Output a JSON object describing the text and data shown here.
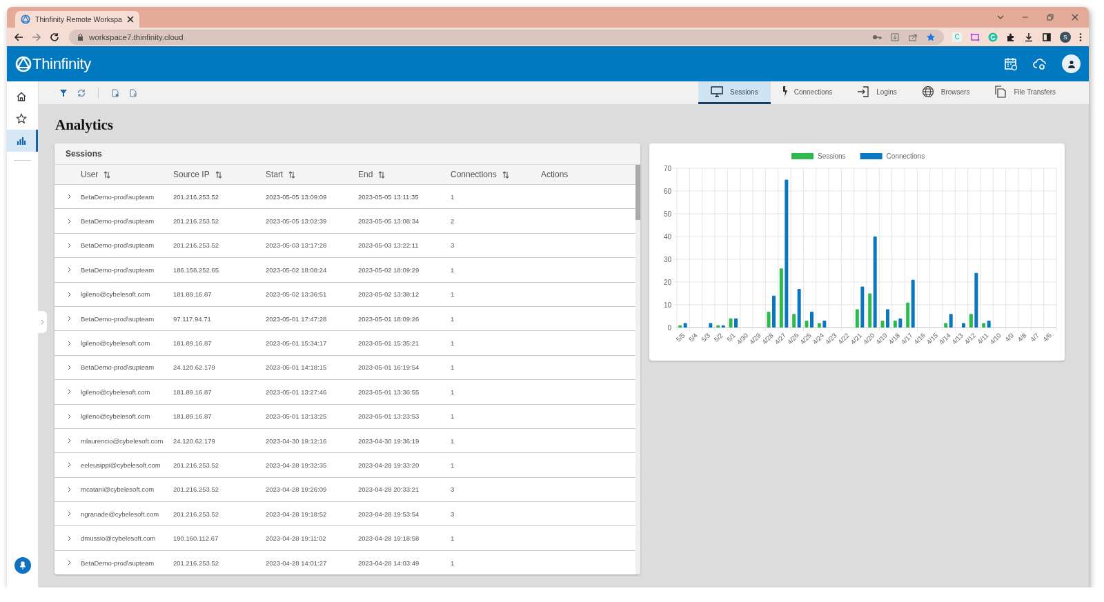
{
  "browser": {
    "tab_title": "Thinfinity Remote Workspa",
    "url": "workspace7.thinfinity.cloud",
    "profile_initial": "S",
    "extension_letter": "C"
  },
  "header": {
    "logo": "Thinfinity"
  },
  "sidebar": {
    "items": [
      {
        "kind": "home",
        "selected": false
      },
      {
        "kind": "star",
        "selected": false
      },
      {
        "kind": "chart",
        "selected": true
      }
    ]
  },
  "view_tabs": [
    {
      "label": "Sessions",
      "kind": "monitor",
      "selected": true
    },
    {
      "label": "Connections",
      "kind": "bolt",
      "selected": false
    },
    {
      "label": "Logins",
      "kind": "login",
      "selected": false
    },
    {
      "label": "Browsers",
      "kind": "globe",
      "selected": false
    },
    {
      "label": "File Transfers",
      "kind": "files",
      "selected": false
    }
  ],
  "page_title": "Analytics",
  "table": {
    "title": "Sessions",
    "columns": [
      {
        "label": "User",
        "sortable": true
      },
      {
        "label": "Source IP",
        "sortable": true
      },
      {
        "label": "Start",
        "sortable": true
      },
      {
        "label": "End",
        "sortable": true
      },
      {
        "label": "Connections",
        "sortable": true
      },
      {
        "label": "Actions",
        "sortable": false
      }
    ],
    "rows": [
      {
        "user": "BetaDemo-prod\\supteam",
        "source_ip": "201.216.253.52",
        "start": "2023-05-05 13:09:09",
        "end": "2023-05-05 13:11:35",
        "connections": "1"
      },
      {
        "user": "BetaDemo-prod\\supteam",
        "source_ip": "201.216.253.52",
        "start": "2023-05-05 13:02:39",
        "end": "2023-05-05 13:08:34",
        "connections": "2"
      },
      {
        "user": "BetaDemo-prod\\supteam",
        "source_ip": "201.216.253.52",
        "start": "2023-05-03 13:17:28",
        "end": "2023-05-03 13:22:11",
        "connections": "3"
      },
      {
        "user": "BetaDemo-prod\\supteam",
        "source_ip": "186.158.252.65",
        "start": "2023-05-02 18:08:24",
        "end": "2023-05-02 18:09:29",
        "connections": "1"
      },
      {
        "user": "lgileno@cybelesoft.com",
        "source_ip": "181.89.16.87",
        "start": "2023-05-02 13:36:51",
        "end": "2023-05-02 13:38:12",
        "connections": "1"
      },
      {
        "user": "BetaDemo-prod\\supteam",
        "source_ip": "97.117.94.71",
        "start": "2023-05-01 17:47:28",
        "end": "2023-05-01 18:09:26",
        "connections": "1"
      },
      {
        "user": "lgileno@cybelesoft.com",
        "source_ip": "181.89.16.87",
        "start": "2023-05-01 15:34:17",
        "end": "2023-05-01 15:35:21",
        "connections": "1"
      },
      {
        "user": "BetaDemo-prod\\supteam",
        "source_ip": "24.120.62.179",
        "start": "2023-05-01 14:18:15",
        "end": "2023-05-01 16:19:54",
        "connections": "1"
      },
      {
        "user": "lgileno@cybelesoft.com",
        "source_ip": "181.89.16.87",
        "start": "2023-05-01 13:27:46",
        "end": "2023-05-01 13:36:55",
        "connections": "1"
      },
      {
        "user": "lgileno@cybelesoft.com",
        "source_ip": "181.89.16.87",
        "start": "2023-05-01 13:13:25",
        "end": "2023-05-01 13:23:53",
        "connections": "1"
      },
      {
        "user": "mlaurencio@cybelesoft.com",
        "source_ip": "24.120.62.179",
        "start": "2023-04-30 19:12:16",
        "end": "2023-04-30 19:36:19",
        "connections": "1"
      },
      {
        "user": "eeleusippi@cybelesoft.com",
        "source_ip": "201.216.253.52",
        "start": "2023-04-28 19:32:35",
        "end": "2023-04-28 19:33:20",
        "connections": "1"
      },
      {
        "user": "mcatani@cybelesoft.com",
        "source_ip": "201.216.253.52",
        "start": "2023-04-28 19:26:09",
        "end": "2023-04-28 20:33:21",
        "connections": "3"
      },
      {
        "user": "ngranade@cybelesoft.com",
        "source_ip": "201.216.253.52",
        "start": "2023-04-28 19:18:52",
        "end": "2023-04-28 19:53:54",
        "connections": "3"
      },
      {
        "user": "dmussio@cybelesoft.com",
        "source_ip": "190.160.112.67",
        "start": "2023-04-28 19:11:02",
        "end": "2023-04-28 19:18:58",
        "connections": "1"
      },
      {
        "user": "BetaDemo-prod\\supteam",
        "source_ip": "201.216.253.52",
        "start": "2023-04-28 14:01:27",
        "end": "2023-04-28 14:03:49",
        "connections": "1"
      }
    ]
  },
  "chart": {
    "chart_data": {
      "type": "bar",
      "categories": [
        "5/5",
        "5/4",
        "5/3",
        "5/2",
        "5/1",
        "4/30",
        "4/29",
        "4/28",
        "4/27",
        "4/26",
        "4/25",
        "4/24",
        "4/23",
        "4/22",
        "4/21",
        "4/20",
        "4/19",
        "4/18",
        "4/17",
        "4/16",
        "4/15",
        "4/14",
        "4/13",
        "4/12",
        "4/11",
        "4/10",
        "4/9",
        "4/8",
        "4/7",
        "4/6"
      ],
      "series": [
        {
          "name": "Sessions",
          "color": "#2db94d",
          "values": [
            1,
            0,
            0,
            1,
            4,
            0,
            0,
            7,
            26,
            6,
            3,
            2,
            0,
            0,
            8,
            15,
            3,
            3,
            11,
            0,
            0,
            2,
            0,
            6,
            2,
            0,
            0,
            0,
            0,
            0
          ]
        },
        {
          "name": "Connections",
          "color": "#0a77c2",
          "values": [
            2,
            0,
            2,
            1,
            4,
            0,
            0,
            14,
            65,
            17,
            7,
            3,
            0,
            0,
            18,
            40,
            8,
            4,
            21,
            0,
            0,
            6,
            2,
            24,
            3,
            0,
            0,
            0,
            0,
            0
          ]
        }
      ],
      "grid": true,
      "legend": true,
      "ylim": [
        0,
        70
      ],
      "yticks": [
        0,
        10,
        20,
        30,
        40,
        50,
        60,
        70
      ]
    }
  }
}
